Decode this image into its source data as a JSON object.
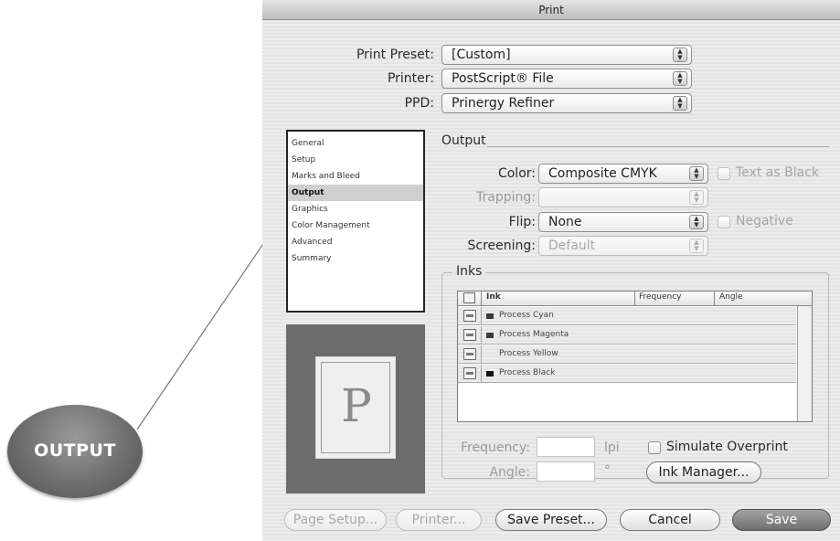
{
  "callout": {
    "text": "OUTPUT"
  },
  "window": {
    "title": "Print"
  },
  "print_preset": {
    "label": "Print Preset:",
    "value": "[Custom]"
  },
  "printer": {
    "label": "Printer:",
    "value": "PostScript® File"
  },
  "ppd": {
    "label": "PPD:",
    "value": "Prinergy Refiner"
  },
  "categories": [
    {
      "label": "General",
      "selected": false
    },
    {
      "label": "Setup",
      "selected": false
    },
    {
      "label": "Marks and Bleed",
      "selected": false
    },
    {
      "label": "Output",
      "selected": true
    },
    {
      "label": "Graphics",
      "selected": false
    },
    {
      "label": "Color Management",
      "selected": false
    },
    {
      "label": "Advanced",
      "selected": false
    },
    {
      "label": "Summary",
      "selected": false
    }
  ],
  "preview": {
    "letter": "P"
  },
  "output": {
    "section_title": "Output",
    "color": {
      "label": "Color:",
      "value": "Composite CMYK",
      "checkbox_label": "Text as Black"
    },
    "trapping": {
      "label": "Trapping:",
      "value": ""
    },
    "flip": {
      "label": "Flip:",
      "value": "None",
      "checkbox_label": "Negative"
    },
    "screening": {
      "label": "Screening:",
      "value": "Default"
    }
  },
  "inks": {
    "title": "Inks",
    "columns": [
      "Ink",
      "Frequency",
      "Angle"
    ],
    "rows": [
      {
        "name": "Process Cyan",
        "swatch": "#3a3a3a"
      },
      {
        "name": "Process Magenta",
        "swatch": "#3a3a3a"
      },
      {
        "name": "Process Yellow",
        "swatch": "#e6e6e6"
      },
      {
        "name": "Process Black",
        "swatch": "#111111"
      }
    ],
    "frequency": {
      "label": "Frequency:",
      "unit": "lpi",
      "value": ""
    },
    "angle": {
      "label": "Angle:",
      "unit": "°",
      "value": ""
    },
    "simulate_overprint": {
      "label": "Simulate Overprint",
      "checked": false
    },
    "ink_manager_label": "Ink Manager..."
  },
  "buttons": {
    "page_setup": "Page Setup...",
    "printer": "Printer...",
    "save_preset": "Save Preset...",
    "cancel": "Cancel",
    "save": "Save"
  }
}
